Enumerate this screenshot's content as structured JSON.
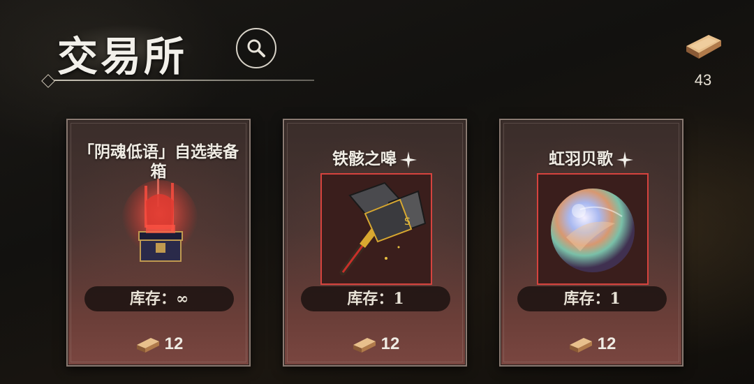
{
  "header": {
    "title": "交易所"
  },
  "currency": {
    "amount": "43"
  },
  "shop": {
    "items": [
      {
        "name": "「阴魂低语」自选装备箱",
        "stock": "库存：∞",
        "price": "12",
        "featured": false
      },
      {
        "name": "铁骸之嗥",
        "stock": "库存：1",
        "price": "12",
        "featured": true
      },
      {
        "name": "虹羽贝歌",
        "stock": "库存：1",
        "price": "12",
        "featured": true
      }
    ]
  },
  "icons": {
    "search": "search-icon",
    "currency": "gold-ingot-icon",
    "sparkle": "sparkle-icon"
  },
  "colors": {
    "rarity_frame": "#d6433e",
    "card_bg": "#4a3532",
    "text": "#f0ece4"
  }
}
